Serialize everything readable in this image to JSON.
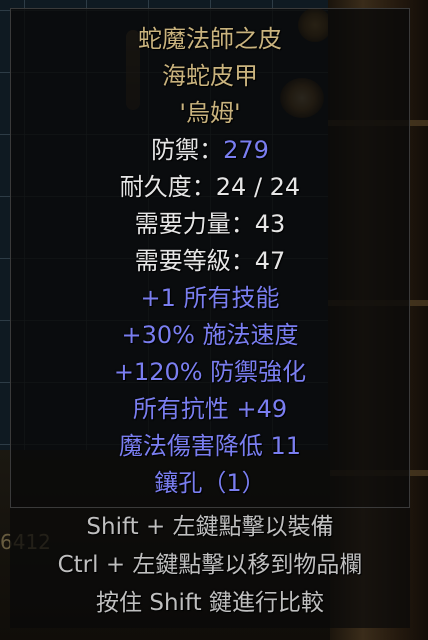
{
  "item": {
    "name": "蛇魔法師之皮",
    "base": "海蛇皮甲",
    "rune": "'烏姆'",
    "defense_label": "防禦：",
    "defense_value": "279",
    "durability": "耐久度：24 / 24",
    "req_str": "需要力量：43",
    "req_level": "需要等級：47",
    "mods": [
      "+1 所有技能",
      "+30% 施法速度",
      "+120% 防禦強化",
      "所有抗性 +49",
      "魔法傷害降低 11",
      "鑲孔（1）"
    ]
  },
  "hints": [
    "Shift + 左鍵點擊以裝備",
    "Ctrl + 左鍵點擊以移到物品欄",
    "按住 Shift 鍵進行比較"
  ],
  "gold_readout": "6412",
  "colors": {
    "unique_gold": "#c9b37e",
    "magic_blue": "#7a7ef0",
    "normal_white": "#e6e6e6"
  }
}
